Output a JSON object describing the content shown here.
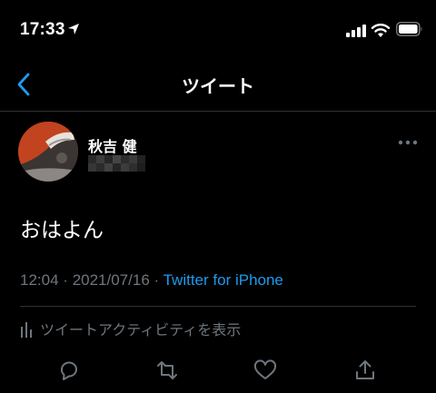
{
  "status_bar": {
    "time": "17:33"
  },
  "nav": {
    "title": "ツイート"
  },
  "tweet": {
    "author_name": "秋吉 健",
    "text": "おはよん",
    "time": "12:04",
    "separator": "·",
    "date": "2021/07/16",
    "source": "Twitter for iPhone"
  },
  "activity": {
    "label": "ツイートアクティビティを表示"
  },
  "colors": {
    "accent": "#1d9bf0",
    "muted": "#6e767d",
    "background": "#000000",
    "divider": "#2f3336"
  },
  "icons": [
    "location-arrow-icon",
    "signal-icon",
    "wifi-icon",
    "battery-icon",
    "back-chevron-icon",
    "more-icon",
    "analytics-icon",
    "reply-icon",
    "retweet-icon",
    "like-icon",
    "share-icon"
  ]
}
